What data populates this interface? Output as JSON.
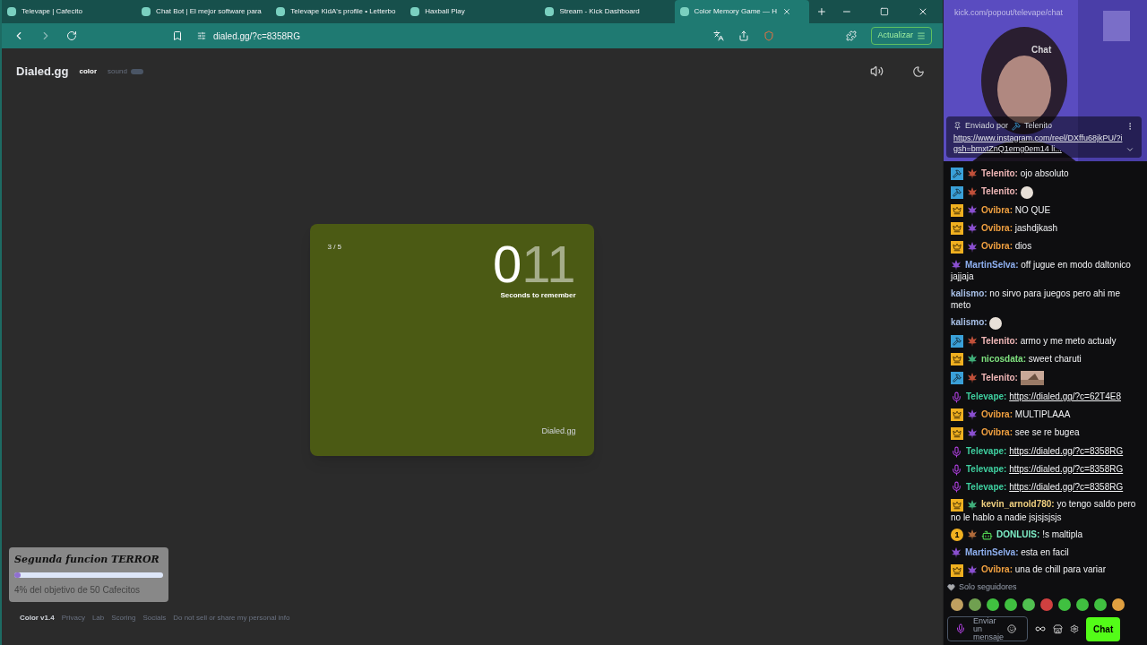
{
  "browser": {
    "tabs": [
      {
        "title": "Televape | Cafecito",
        "selected": false
      },
      {
        "title": "Chat Bot | El mejor software para",
        "selected": false
      },
      {
        "title": "Televape KidA's profile • Letterbo",
        "selected": false
      },
      {
        "title": "Haxball Play",
        "selected": false
      },
      {
        "title": "Stream - Kick Dashboard",
        "selected": false
      },
      {
        "title": "Color Memory Game — H",
        "selected": true
      }
    ],
    "address": "dialed.gg/?c=8358RG",
    "update_button": "Actualizar"
  },
  "app": {
    "logo": "Dialed.gg",
    "nav": [
      {
        "label": "color",
        "selected": true
      },
      {
        "label": "sound",
        "selected": false
      }
    ]
  },
  "card": {
    "color": "#4b5a14",
    "progress": "3 / 5",
    "timer_lead": "0",
    "timer_rest": "11",
    "timer_caption": "Seconds to remember",
    "brand": "Dialed.gg"
  },
  "goal": {
    "title": "Segunda funcion TERROR",
    "level": 0.04,
    "caption": "4% del objetivo de 50 Cafecitos"
  },
  "footer": {
    "version": "Color v1.4",
    "links": [
      "Privacy",
      "Lab",
      "Scoring",
      "Socials",
      "Do not sell or share my personal info"
    ]
  },
  "chat": {
    "url": "kick.com/popout/televape/chat",
    "title": "Chat",
    "pinned": {
      "label": "Enviado por",
      "user": "Telenito",
      "link": "https://www.instagram.com/reel/DXffu68jkPU/?igsh=bmxtZnQ1emg0em14 li..."
    },
    "messages": [
      {
        "badges": [
          {
            "kind": "mod"
          },
          {
            "kind": "leaf",
            "color": "#c0503a"
          }
        ],
        "user": "Telenito:",
        "color": "#f0b7b7",
        "text": "ojo absoluto"
      },
      {
        "badges": [
          {
            "kind": "mod"
          },
          {
            "kind": "leaf",
            "color": "#c0503a"
          }
        ],
        "user": "Telenito:",
        "color": "#f0b7b7",
        "kind": "emote"
      },
      {
        "badges": [
          {
            "kind": "vip"
          },
          {
            "kind": "leaf",
            "color": "#8a4fd0"
          }
        ],
        "user": "Ovibra:",
        "color": "#f0a040",
        "text": "NO QUE"
      },
      {
        "badges": [
          {
            "kind": "vip"
          },
          {
            "kind": "leaf",
            "color": "#8a4fd0"
          }
        ],
        "user": "Ovibra:",
        "color": "#f0a040",
        "text": "jashdjkash"
      },
      {
        "badges": [
          {
            "kind": "vip"
          },
          {
            "kind": "leaf",
            "color": "#8a4fd0"
          }
        ],
        "user": "Ovibra:",
        "color": "#f0a040",
        "text": "dios"
      },
      {
        "badges": [
          {
            "kind": "leaf",
            "color": "#8a4fd0"
          }
        ],
        "user": "MartinSelva:",
        "color": "#8fb0f0",
        "text": "off jugue en modo daltonico jajjaja"
      },
      {
        "user": "kalismo:",
        "color": "#a8c0e8",
        "text": "no sirvo para juegos pero ahi me meto"
      },
      {
        "user": "kalismo:",
        "color": "#a8c0e8",
        "kind": "emote"
      },
      {
        "badges": [
          {
            "kind": "mod"
          },
          {
            "kind": "leaf",
            "color": "#c0503a"
          }
        ],
        "user": "Telenito:",
        "color": "#f0b7b7",
        "text": "armo y me meto actualy"
      },
      {
        "badges": [
          {
            "kind": "vip"
          },
          {
            "kind": "leaf",
            "color": "#3fae7a"
          }
        ],
        "user": "nicosdata:",
        "color": "#7ee07e",
        "text": "sweet charuti"
      },
      {
        "badges": [
          {
            "kind": "mod"
          },
          {
            "kind": "leaf",
            "color": "#c0503a"
          }
        ],
        "user": "Telenito:",
        "color": "#f0b7b7"
      },
      {
        "badges": [
          {
            "kind": "broadcaster"
          }
        ],
        "user": "Televape:",
        "color": "#3fd0a0",
        "link": "https://dialed.gg/?c=62T4E8"
      },
      {
        "badges": [
          {
            "kind": "vip"
          },
          {
            "kind": "leaf",
            "color": "#8a4fd0"
          }
        ],
        "user": "Ovibra:",
        "color": "#f0a040",
        "text": "MULTIPLAAA"
      },
      {
        "badges": [
          {
            "kind": "vip"
          },
          {
            "kind": "leaf",
            "color": "#8a4fd0"
          }
        ],
        "user": "Ovibra:",
        "color": "#f0a040",
        "text": "see se re bugea"
      },
      {
        "badges": [
          {
            "kind": "broadcaster"
          }
        ],
        "user": "Televape:",
        "color": "#3fd0a0",
        "link": "https://dialed.gg/?c=8358RG"
      },
      {
        "badges": [
          {
            "kind": "broadcaster"
          }
        ],
        "user": "Televape:",
        "color": "#3fd0a0",
        "link": "https://dialed.gg/?c=8358RG"
      },
      {
        "badges": [
          {
            "kind": "broadcaster"
          }
        ],
        "user": "Televape:",
        "color": "#3fd0a0",
        "link": "https://dialed.gg/?c=8358RG"
      },
      {
        "badges": [
          {
            "kind": "vip"
          },
          {
            "kind": "leaf",
            "color": "#3fae7a"
          }
        ],
        "user": "kevin_arnold780:",
        "color": "#f0d080",
        "text": "yo tengo saldo pero no le hablo a nadie jsjsjsjsjs"
      },
      {
        "badges": [
          {
            "kind": "gift",
            "label": "1"
          },
          {
            "kind": "leaf",
            "color": "#b06a3a"
          },
          {
            "kind": "robot"
          }
        ],
        "user": "DONLUIS:",
        "color": "#7ef0c8",
        "text": "!s maltipla"
      },
      {
        "badges": [
          {
            "kind": "leaf",
            "color": "#8a4fd0"
          }
        ],
        "user": "MartinSelva:",
        "color": "#8fb0f0",
        "text": "esta en facil"
      },
      {
        "badges": [
          {
            "kind": "vip"
          },
          {
            "kind": "leaf",
            "color": "#8a4fd0"
          }
        ],
        "user": "Ovibra:",
        "color": "#f0a040",
        "text": "una de chill para variar"
      }
    ],
    "mode": "Solo seguidores",
    "input_placeholder": "Enviar un mensaje",
    "send_button": "Chat"
  }
}
